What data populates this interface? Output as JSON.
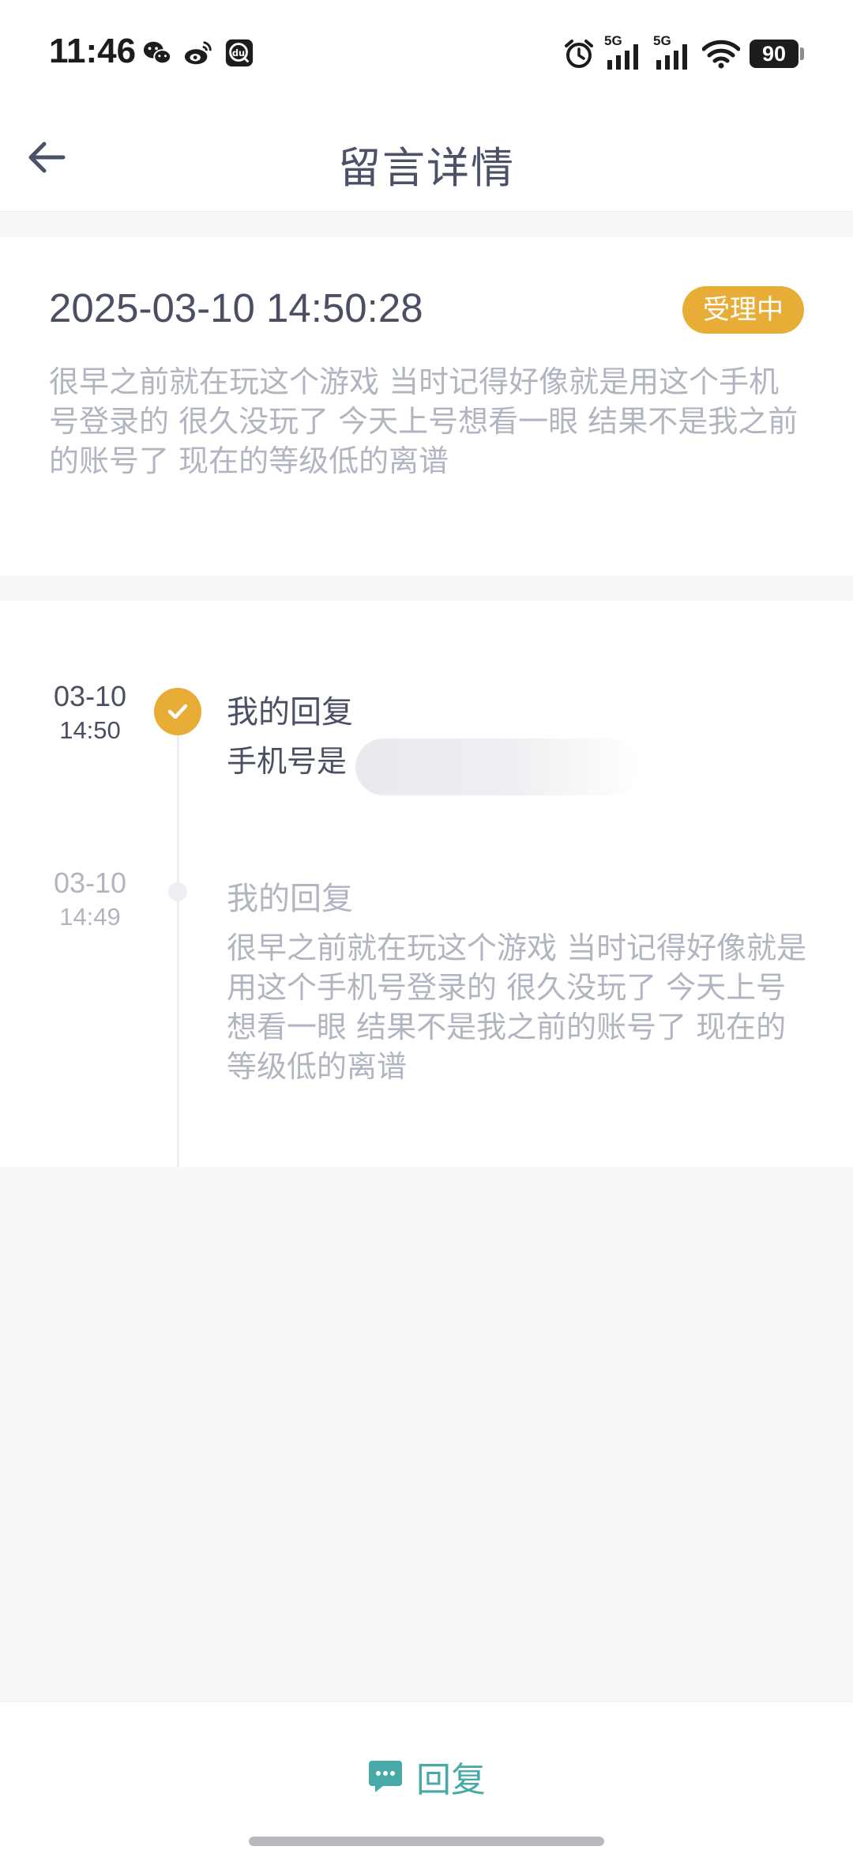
{
  "status_bar": {
    "time": "11:46",
    "signal_1_label": "5G",
    "signal_2_label": "5G",
    "battery": "90",
    "app_icons": [
      "wechat-icon",
      "weibo-icon",
      "app-du-icon"
    ]
  },
  "header": {
    "title": "留言详情"
  },
  "message": {
    "datetime": "2025-03-10 14:50:28",
    "status": "受理中",
    "content": "很早之前就在玩这个游戏 当时记得好像就是用这个手机号登录的 很久没玩了 今天上号想看一眼 结果不是我之前的账号了 现在的等级低的离谱"
  },
  "replies": [
    {
      "date": "03-10",
      "time": "14:50",
      "title": "我的回复",
      "body": "手机号是"
    },
    {
      "date": "03-10",
      "time": "14:49",
      "title": "我的回复",
      "body": "很早之前就在玩这个游戏 当时记得好像就是用这个手机号登录的 很久没玩了 今天上号想看一眼 结果不是我之前的账号了 现在的等级低的离谱"
    }
  ],
  "footer": {
    "reply_label": "回复"
  },
  "colors": {
    "accent": "#e8ad37",
    "teal": "#47a9a8",
    "text_dark": "#4a4f63",
    "text_muted": "#b1b5c2"
  }
}
